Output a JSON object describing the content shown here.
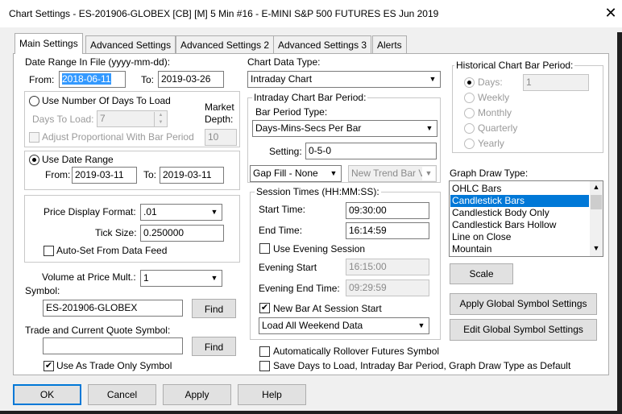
{
  "window": {
    "title": "Chart Settings - ES-201906-GLOBEX [CB] [M]  5 Min   #16 - E-MINI S&P 500 FUTURES ES Jun 2019",
    "close_glyph": "✕"
  },
  "tabs": [
    {
      "label": "Main Settings"
    },
    {
      "label": "Advanced Settings"
    },
    {
      "label": "Advanced Settings 2"
    },
    {
      "label": "Advanced Settings 3"
    },
    {
      "label": "Alerts"
    }
  ],
  "date_range_file": {
    "label": "Date Range In File (yyyy-mm-dd):",
    "from_label": "From:",
    "from_value": "2018-06-11",
    "to_label": "To:",
    "to_value": "2019-03-26"
  },
  "days_to_load": {
    "radio_label": "Use Number Of Days To Load",
    "days_label": "Days To Load:",
    "days_value": "7",
    "adjust_label": "Adjust Proportional With Bar Period",
    "depth_label_1": "Market",
    "depth_label_2": "Depth:",
    "depth_value": "10"
  },
  "date_range": {
    "radio_label": "Use Date Range",
    "from_label": "From:",
    "from_value": "2019-03-11",
    "to_label": "To:",
    "to_value": "2019-03-11"
  },
  "price": {
    "format_label": "Price Display Format:",
    "format_value": ".01",
    "tick_label": "Tick Size:",
    "tick_value": "0.250000",
    "autoset_label": "Auto-Set From Data Feed"
  },
  "volume": {
    "label": "Volume at Price Mult.:",
    "value": "1"
  },
  "symbol": {
    "label": "Symbol:",
    "value": "ES-201906-GLOBEX",
    "find_label": "Find"
  },
  "trade_symbol": {
    "label": "Trade and Current Quote Symbol:",
    "value": "",
    "find_label": "Find",
    "trade_only_label": "Use As Trade Only Symbol"
  },
  "chart_data_type": {
    "label": "Chart Data Type:",
    "value": "Intraday Chart"
  },
  "intraday": {
    "legend": "Intraday Chart Bar Period:",
    "type_label": "Bar Period Type:",
    "type_value": "Days-Mins-Secs Per Bar",
    "setting_label": "Setting:",
    "setting_value": "0-5-0",
    "gap_value": "Gap Fill - None",
    "newtrend_value": "New Trend Bar V"
  },
  "session": {
    "legend": "Session Times (HH:MM:SS):",
    "start_label": "Start Time:",
    "start_value": "09:30:00",
    "end_label": "End Time:",
    "end_value": "16:14:59",
    "evening_check_label": "Use Evening Session",
    "evening_start_label": "Evening Start",
    "evening_start_value": "16:15:00",
    "evening_end_label": "Evening End Time:",
    "evening_end_value": "09:29:59",
    "newbar_label": "New Bar At Session Start",
    "weekend_value": "Load All Weekend Data"
  },
  "rollover_label": "Automatically Rollover Futures Symbol",
  "save_default_label": "Save Days to Load, Intraday Bar Period, Graph Draw Type as Default",
  "historical": {
    "legend": "Historical Chart Bar Period:",
    "days_label": "Days:",
    "days_value": "1",
    "weekly_label": "Weekly",
    "monthly_label": "Monthly",
    "quarterly_label": "Quarterly",
    "yearly_label": "Yearly"
  },
  "graph_draw": {
    "label": "Graph Draw Type:",
    "items": [
      "OHLC Bars",
      "Candlestick Bars",
      "Candlestick Body Only",
      "Candlestick Bars Hollow",
      "Line on Close",
      "Mountain"
    ],
    "selected": "Candlestick Bars"
  },
  "buttons": {
    "scale": "Scale",
    "apply_global": "Apply Global Symbol Settings",
    "edit_global": "Edit Global Symbol Settings",
    "ok": "OK",
    "cancel": "Cancel",
    "apply": "Apply",
    "help": "Help"
  },
  "glyphs": {
    "check": "✔",
    "arrow_down": "▼",
    "arrow_up": "▲"
  }
}
